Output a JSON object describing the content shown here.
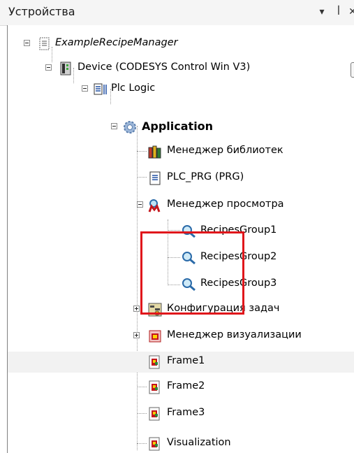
{
  "panel": {
    "title": "Устройства",
    "buttons": {
      "dropdown": "▾",
      "pin": "ꟾ",
      "close": "✕"
    }
  },
  "tree": {
    "project": "ExampleRecipeManager",
    "device": "Device (CODESYS Control Win V3)",
    "plc_logic": "Plc Logic",
    "application": "Application",
    "library_manager": "Менеджер библиотек",
    "plc_prg": "PLC_PRG (PRG)",
    "watch_manager": "Менеджер просмотра",
    "recipes_group_1": "RecipesGroup1",
    "recipes_group_2": "RecipesGroup2",
    "recipes_group_3": "RecipesGroup3",
    "task_config": "Конфигурация задач",
    "visu_manager": "Менеджер визуализации",
    "frame_1": "Frame1",
    "frame_2": "Frame2",
    "frame_3": "Frame3",
    "visualization": "Visualization"
  },
  "colors": {
    "highlight_border": "#e0161b",
    "selected_row": "#f2f2f2"
  }
}
